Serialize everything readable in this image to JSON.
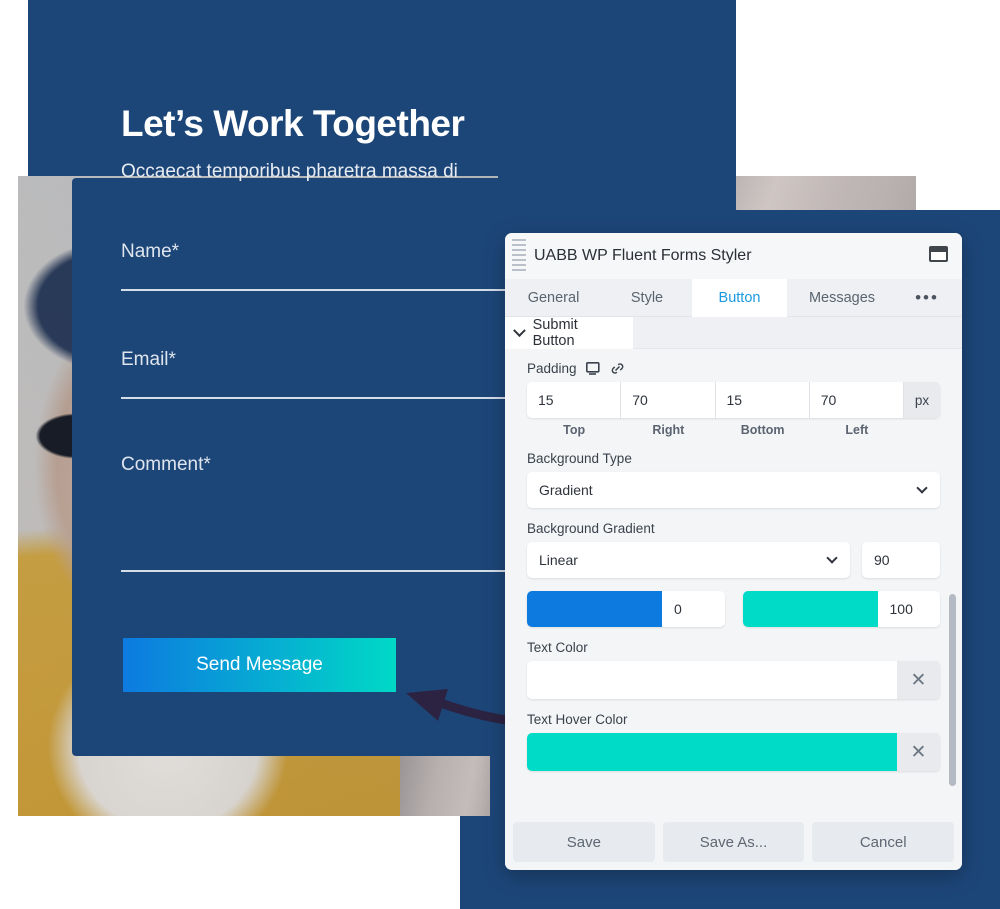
{
  "hero": {
    "title": "Let’s Work Together",
    "subtitle": "Occaecat temporibus pharetra massa di"
  },
  "contact_form": {
    "fields": [
      {
        "label": "Name*",
        "value": ""
      },
      {
        "label": "Email*",
        "value": ""
      },
      {
        "label": "Comment*",
        "value": ""
      }
    ],
    "submit_label": "Send Message",
    "submit_gradient_from": "#0d7ae0",
    "submit_gradient_to": "#00d9c6"
  },
  "styler": {
    "window_title": "UABB WP Fluent Forms Styler",
    "restore_icon": "window-restore-icon",
    "drag_handle_icon": "drag-handle-icon",
    "tabs": [
      {
        "label": "General",
        "active": false
      },
      {
        "label": "Style",
        "active": false
      },
      {
        "label": "Button",
        "active": true
      },
      {
        "label": "Messages",
        "active": false
      },
      {
        "label": "•••",
        "active": false
      }
    ],
    "section": {
      "label": "Submit Button",
      "expanded": true
    },
    "padding": {
      "label": "Padding",
      "device_icon": "desktop-icon",
      "link_icon": "link-icon",
      "unit": "px",
      "values": [
        "15",
        "70",
        "15",
        "70"
      ],
      "legends": [
        "Top",
        "Right",
        "Bottom",
        "Left"
      ]
    },
    "background_type": {
      "label": "Background Type",
      "value": "Gradient"
    },
    "background_gradient": {
      "label": "Background Gradient",
      "type": "Linear",
      "angle": "90",
      "stops": [
        {
          "color": "#0d7ae0",
          "position": "0"
        },
        {
          "color": "#00dbc8",
          "position": "100"
        }
      ]
    },
    "text_color": {
      "label": "Text Color",
      "value": "",
      "swatch": "#ffffff",
      "clear_icon": "close-icon"
    },
    "text_hover_color": {
      "label": "Text Hover Color",
      "value": "#00dbc8",
      "swatch": "#00dbc8",
      "clear_icon": "close-icon"
    },
    "footer": {
      "save": "Save",
      "save_as": "Save As...",
      "cancel": "Cancel"
    },
    "accent_color": "#1a9ae0"
  },
  "annotation": {
    "arrow_icon": "curved-arrow-icon",
    "arrow_color": "#2c2342"
  }
}
